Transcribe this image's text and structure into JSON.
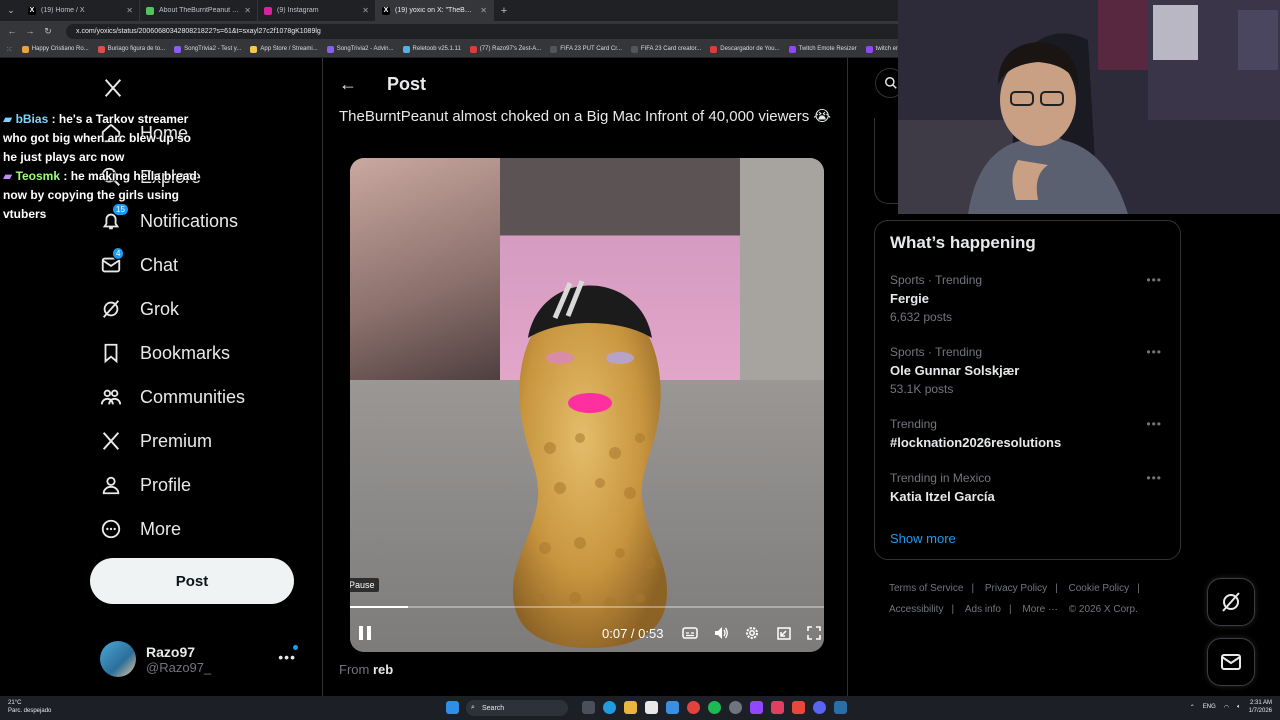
{
  "browser": {
    "tabs": [
      {
        "title": "(19) Home / X",
        "icon": "x-logo-icon",
        "active": false,
        "color": "#000000"
      },
      {
        "title": "About TheBurntPeanut - Watch",
        "icon": "twitch-icon",
        "active": false,
        "color": "#53c35e"
      },
      {
        "title": "(9) Instagram",
        "icon": "instagram-icon",
        "active": false,
        "color": "#d6249f"
      },
      {
        "title": "(19) yoxic on X: \"TheBurnt",
        "icon": "x-logo-icon",
        "active": true,
        "color": "#000000"
      }
    ],
    "url": "x.com/yoxics/status/2006068034280821822?s=61&t=sxayl27c2f1078gK1089lg",
    "bookmarks": [
      {
        "label": "Happy Cristiano Ro...",
        "color": "#e8a33d"
      },
      {
        "label": "Buriago figura de to...",
        "color": "#e04c4c"
      },
      {
        "label": "SongTrivia2 - Test y...",
        "color": "#8b5cf6"
      },
      {
        "label": "App Store / Streami...",
        "color": "#f2c94c"
      },
      {
        "label": "SongTrivia2 - Advin...",
        "color": "#8b5cf6"
      },
      {
        "label": "Reletoob v25.1.11",
        "color": "#4fb3e8"
      },
      {
        "label": "(77) Razo97's Zest-A...",
        "color": "#e03b3b"
      },
      {
        "label": "FIFA 23 PUT Card Cr...",
        "color": "#555555"
      },
      {
        "label": "FIFA 23 Card creator...",
        "color": "#555555"
      },
      {
        "label": "Descargador de You...",
        "color": "#e03b3b"
      },
      {
        "label": "Twitch Emote Resizer",
        "color": "#9146ff"
      },
      {
        "label": "twitch em",
        "color": "#9146ff"
      }
    ]
  },
  "chat": [
    {
      "user": "bBias",
      "text": " : he's a Tarkov streamer who got big when arc blew up so he just plays arc now",
      "color": "#7cd4ff"
    },
    {
      "user": "Teosmk",
      "text": " : he making hella bread now by copying the girls using vtubers",
      "color": "#9cff7a"
    }
  ],
  "nav": {
    "items": [
      {
        "label": "Home",
        "icon": "home-icon"
      },
      {
        "label": "Explore",
        "icon": "search-icon"
      },
      {
        "label": "Notifications",
        "icon": "bell-icon",
        "badge": "15"
      },
      {
        "label": "Chat",
        "icon": "mail-icon",
        "badge": "4"
      },
      {
        "label": "Grok",
        "icon": "grok-icon"
      },
      {
        "label": "Bookmarks",
        "icon": "bookmark-icon"
      },
      {
        "label": "Communities",
        "icon": "communities-icon"
      },
      {
        "label": "Premium",
        "icon": "x-logo-icon"
      },
      {
        "label": "Profile",
        "icon": "profile-icon"
      },
      {
        "label": "More",
        "icon": "more-circle-icon"
      }
    ],
    "post_label": "Post",
    "account": {
      "name": "Razo97",
      "handle": "@Razo97_"
    }
  },
  "main": {
    "title": "Post",
    "post_text": "TheBurntPeanut almost choked on a Big Mac Infront of 40,000 viewers 😭",
    "video": {
      "tooltip": "Pause",
      "time_current": "0:07",
      "time_total": "0:53",
      "time_display": "0:07 / 0:53",
      "progress": 0.13
    },
    "from_prefix": "From ",
    "from_name": "reb"
  },
  "sidebar": {
    "trends_title": "What’s happening",
    "trends": [
      {
        "category": "Sports · Trending",
        "name": "Fergie",
        "count": "6,632 posts"
      },
      {
        "category": "Sports · Trending",
        "name": "Ole Gunnar Solskjær",
        "count": "53.1K posts"
      },
      {
        "category": "Trending",
        "name": "#locknation2026resolutions",
        "count": ""
      },
      {
        "category": "Trending in Mexico",
        "name": "Katia Itzel García",
        "count": ""
      }
    ],
    "show_more": "Show more",
    "footer": [
      "Terms of Service",
      "Privacy Policy",
      "Cookie Policy",
      "Accessibility",
      "Ads info",
      "More ···",
      "© 2026 X Corp."
    ]
  },
  "taskbar": {
    "weather_temp": "21°C",
    "weather_desc": "Parc. despejado",
    "search_label": "Search",
    "lang": "ENG",
    "time": "2:31 AM",
    "date": "1/7/2026"
  }
}
